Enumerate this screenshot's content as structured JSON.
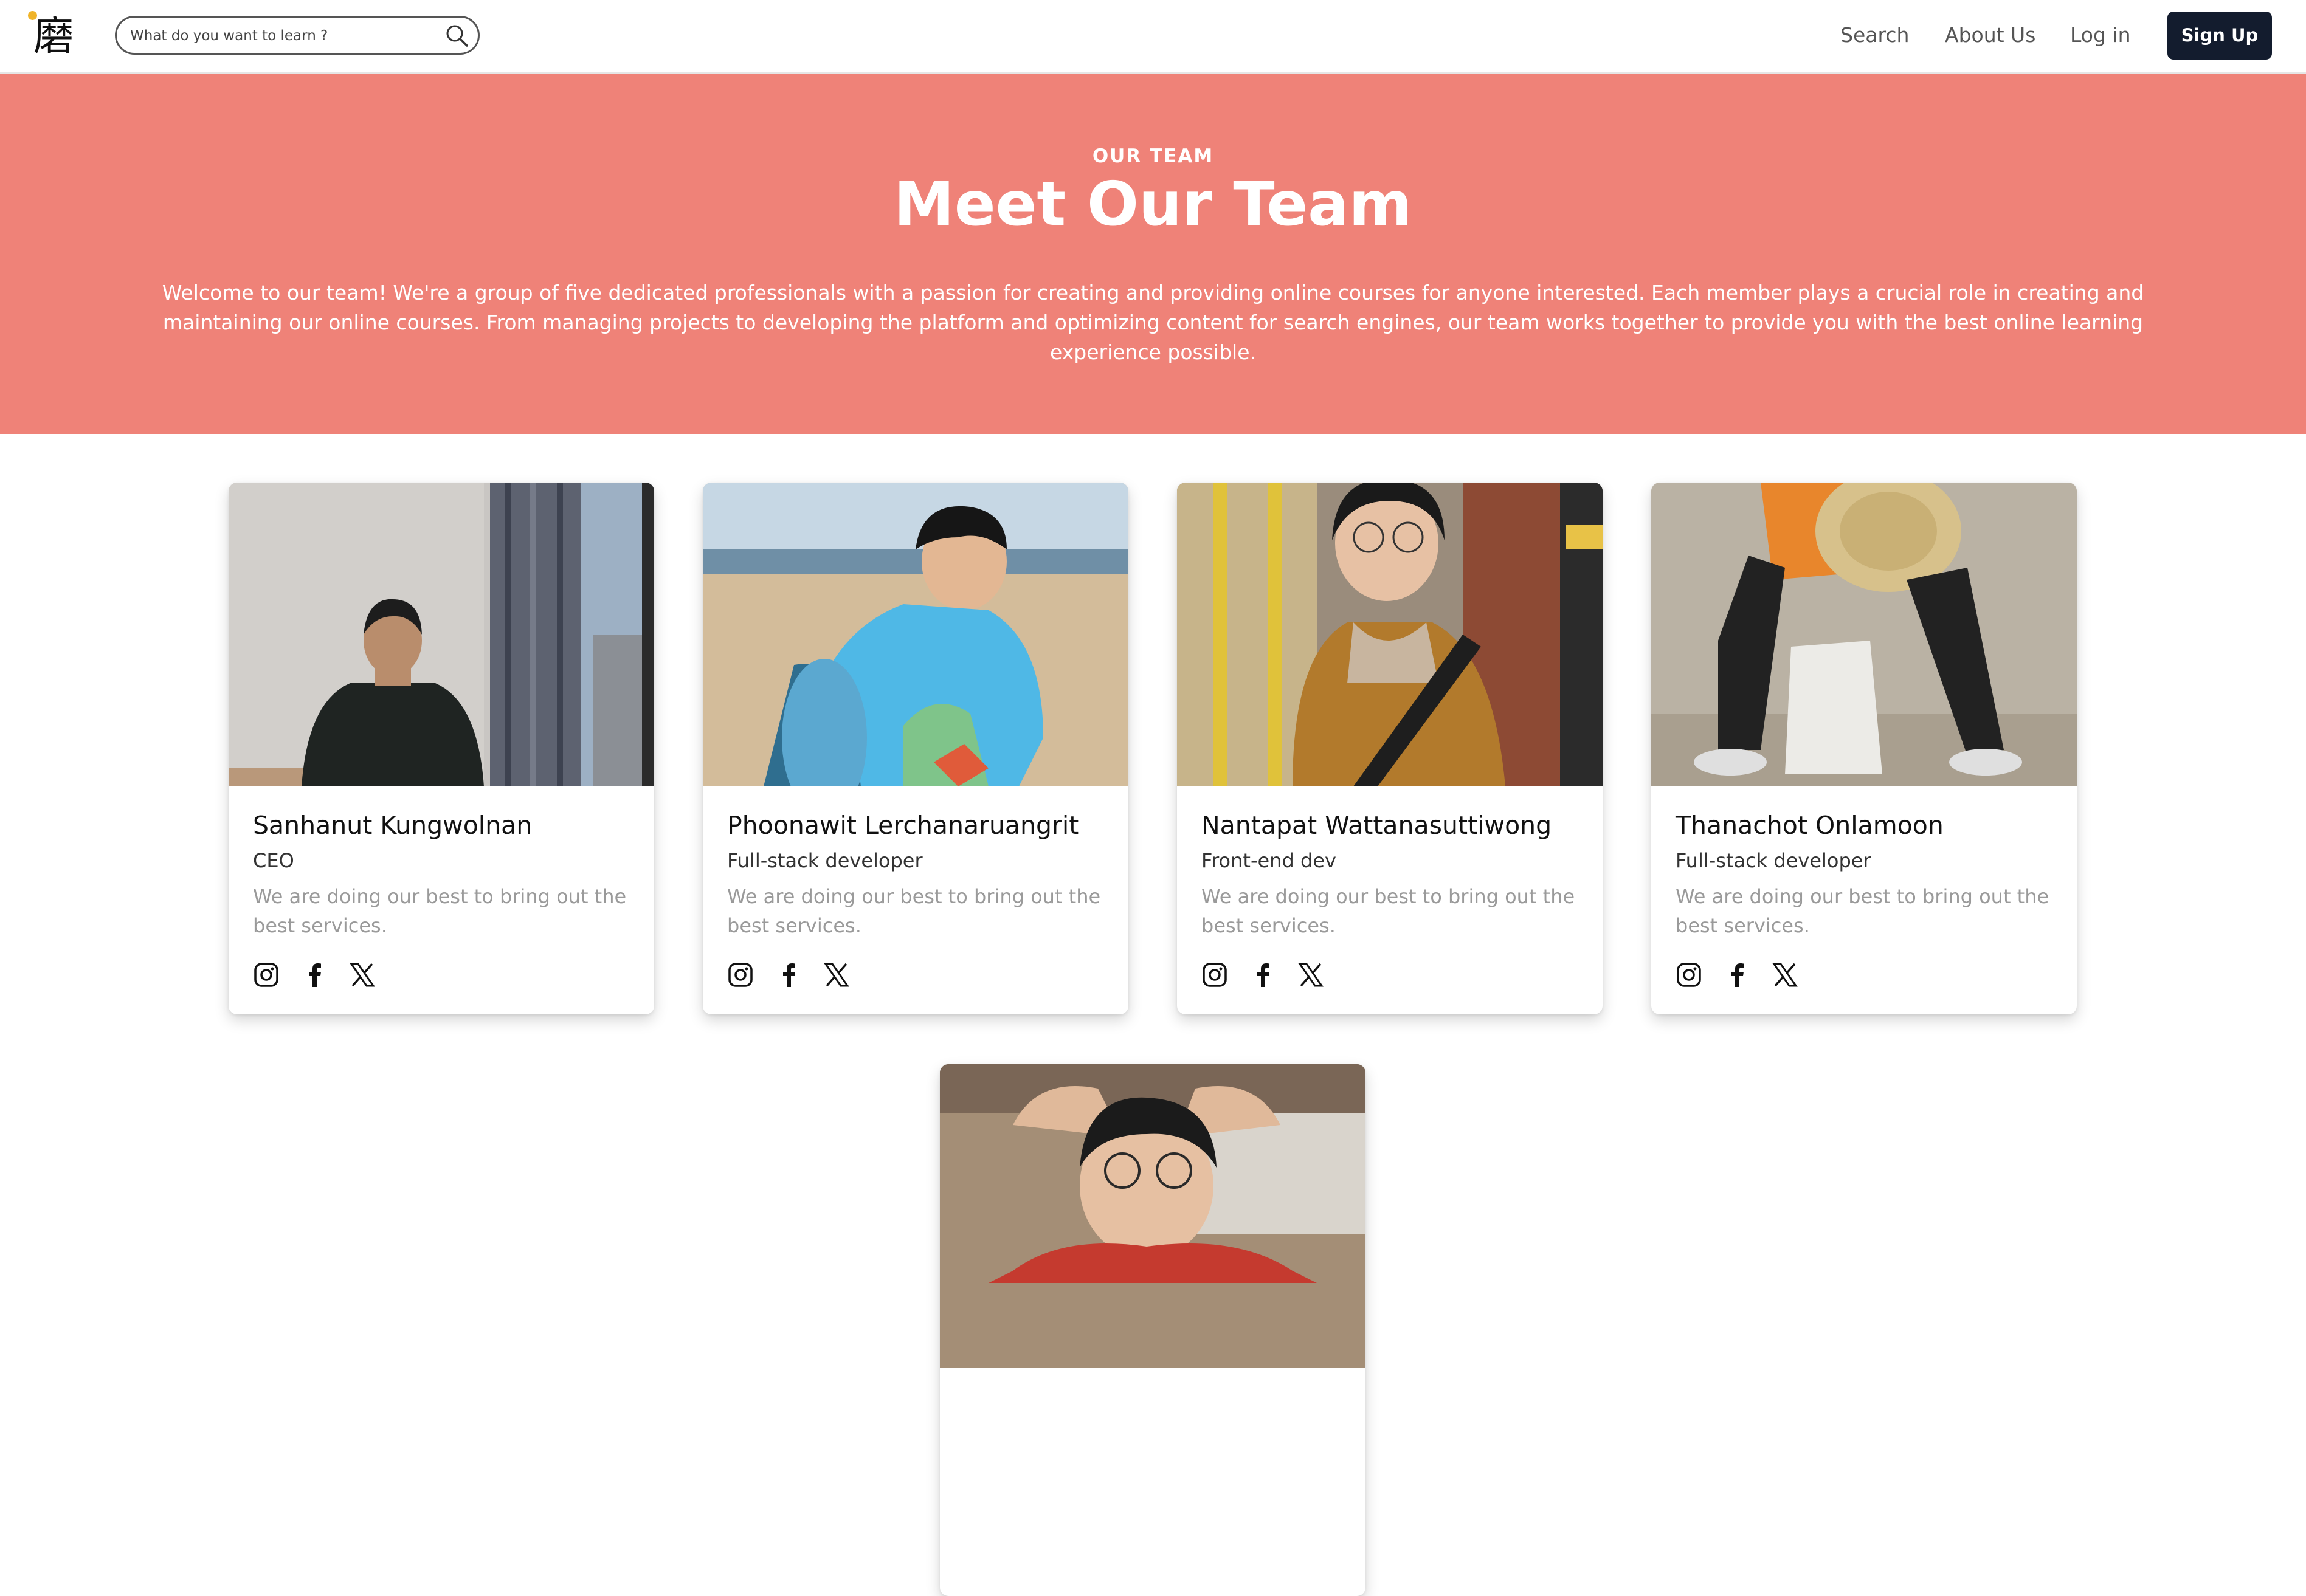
{
  "nav": {
    "logo_text": "磨",
    "search_placeholder": "What do you want to learn ?",
    "links": [
      "Search",
      "About Us",
      "Log in"
    ],
    "signup_label": "Sign Up"
  },
  "hero": {
    "eyebrow": "OUR TEAM",
    "title": "Meet Our Team",
    "description": "Welcome to our team! We're a group of five dedicated professionals with a passion for creating and providing online courses for anyone interested. Each member plays a crucial role in creating and maintaining our online courses. From managing projects to developing the platform and optimizing content for search engines, our team works together to provide you with the best online learning experience possible."
  },
  "team": [
    {
      "name": "Sanhanut Kungwolnan",
      "role": "CEO",
      "bio": "We are doing our best to bring out the best services."
    },
    {
      "name": "Phoonawit Lerchanaruangrit",
      "role": "Full-stack developer",
      "bio": "We are doing our best to bring out the best services."
    },
    {
      "name": "Nantapat Wattanasuttiwong",
      "role": "Front-end dev",
      "bio": "We are doing our best to bring out the best services."
    },
    {
      "name": "Thanachot Onlamoon",
      "role": "Full-stack developer",
      "bio": "We are doing our best to bring out the best services."
    }
  ],
  "social_icons": [
    "instagram-icon",
    "facebook-icon",
    "x-twitter-icon"
  ],
  "colors": {
    "hero_bg": "#ef8278",
    "signup_bg": "#131c2e",
    "logo_dot": "#f0b429"
  }
}
